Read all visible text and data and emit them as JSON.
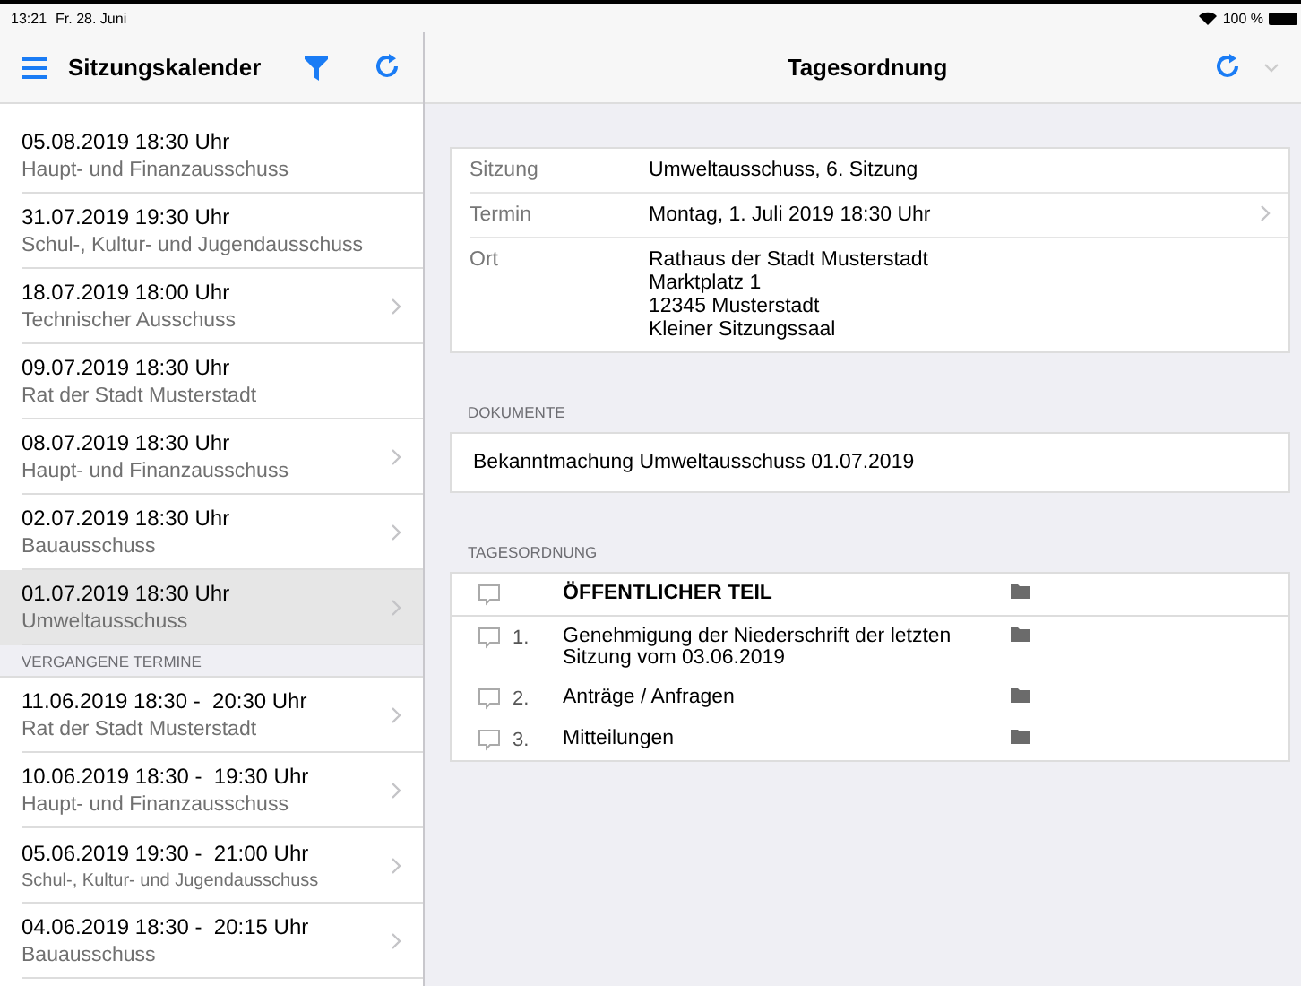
{
  "status_bar": {
    "time": "13:21",
    "date": "Fr. 28. Juni",
    "battery": "100 %"
  },
  "sidebar": {
    "title": "Sitzungskalender",
    "upcoming": [
      {
        "datetime": "05.08.2019 18:30 Uhr",
        "committee": "Haupt- und Finanzausschuss",
        "chevron": false,
        "selected": false
      },
      {
        "datetime": "31.07.2019 19:30 Uhr",
        "committee": "Schul-, Kultur- und Jugendausschuss",
        "chevron": false,
        "selected": false
      },
      {
        "datetime": "18.07.2019 18:00 Uhr",
        "committee": "Technischer Ausschuss",
        "chevron": true,
        "selected": false
      },
      {
        "datetime": "09.07.2019 18:30 Uhr",
        "committee": "Rat der Stadt Musterstadt",
        "chevron": false,
        "selected": false
      },
      {
        "datetime": "08.07.2019 18:30 Uhr",
        "committee": "Haupt- und Finanzausschuss",
        "chevron": true,
        "selected": false
      },
      {
        "datetime": "02.07.2019 18:30 Uhr",
        "committee": "Bauausschuss",
        "chevron": true,
        "selected": false
      },
      {
        "datetime": "01.07.2019 18:30 Uhr",
        "committee": "Umweltausschuss",
        "chevron": true,
        "selected": true
      }
    ],
    "past_header": "VERGANGENE TERMINE",
    "past": [
      {
        "datetime": "11.06.2019 18:30 -  20:30 Uhr",
        "committee": "Rat der Stadt Musterstadt",
        "chevron": true,
        "selected": false
      },
      {
        "datetime": "10.06.2019 18:30 -  19:30 Uhr",
        "committee": "Haupt- und Finanzausschuss",
        "chevron": true,
        "selected": false
      },
      {
        "datetime": "05.06.2019 19:30 -  21:00 Uhr",
        "committee": "Schul-, Kultur- und Jugendausschuss",
        "chevron": true,
        "selected": false
      },
      {
        "datetime": "04.06.2019 18:30 -  20:15 Uhr",
        "committee": "Bauausschuss",
        "chevron": true,
        "selected": false
      }
    ]
  },
  "detail": {
    "title": "Tagesordnung",
    "info": [
      {
        "label": "Sitzung",
        "value": [
          "Umweltausschuss, 6. Sitzung"
        ],
        "chevron": false
      },
      {
        "label": "Termin",
        "value": [
          "Montag, 1. Juli 2019 18:30 Uhr"
        ],
        "chevron": true
      },
      {
        "label": "Ort",
        "value": [
          "Rathaus der Stadt Musterstadt",
          "Marktplatz 1",
          "12345 Musterstadt",
          "Kleiner Sitzungssaal"
        ],
        "chevron": false
      }
    ],
    "documents_header": "DOKUMENTE",
    "documents": [
      "Bekanntmachung Umweltausschuss 01.07.2019"
    ],
    "agenda_header": "TAGESORDNUNG",
    "agenda": [
      {
        "kind": "section",
        "title": "ÖFFENTLICHER TEIL"
      },
      {
        "kind": "item",
        "number": "1.",
        "title": "Genehmigung der Niederschrift der letzten Sitzung vom 03.06.2019"
      },
      {
        "kind": "item",
        "number": "2.",
        "title": "Anträge / Anfragen"
      },
      {
        "kind": "item",
        "number": "3.",
        "title": "Mitteilungen"
      }
    ]
  }
}
